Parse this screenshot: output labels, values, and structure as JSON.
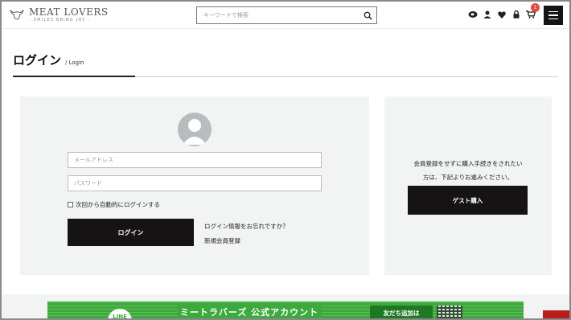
{
  "brand": {
    "name": "MEAT LOVERS",
    "tagline": "- SMILES BRING JOY -"
  },
  "header": {
    "search_placeholder": "キーワードで検索",
    "cart_count": "1"
  },
  "page": {
    "title": "ログイン",
    "subtitle": "/ Login"
  },
  "login": {
    "email_placeholder": "メールアドレス",
    "password_placeholder": "パスワード",
    "remember_label": "次回から自動的にログインする",
    "submit_label": "ログイン",
    "forgot_link": "ログイン情報をお忘れですか？",
    "register_link": "新規会員登録"
  },
  "guest": {
    "text_line1": "会員登録をせずに購入手続きをされたい",
    "text_line2": "方は、下記よりお進みください。",
    "button_label": "ゲスト購入"
  },
  "line_banner": {
    "logo_label": "LINE",
    "title": "ミートラバーズ 公式アカウント",
    "button_label": "友だち追加は"
  },
  "colors": {
    "accent_dark": "#151313",
    "panel_bg": "#f2f3f3",
    "line_green": "#3daa3d",
    "badge_red": "#e34b3b"
  }
}
